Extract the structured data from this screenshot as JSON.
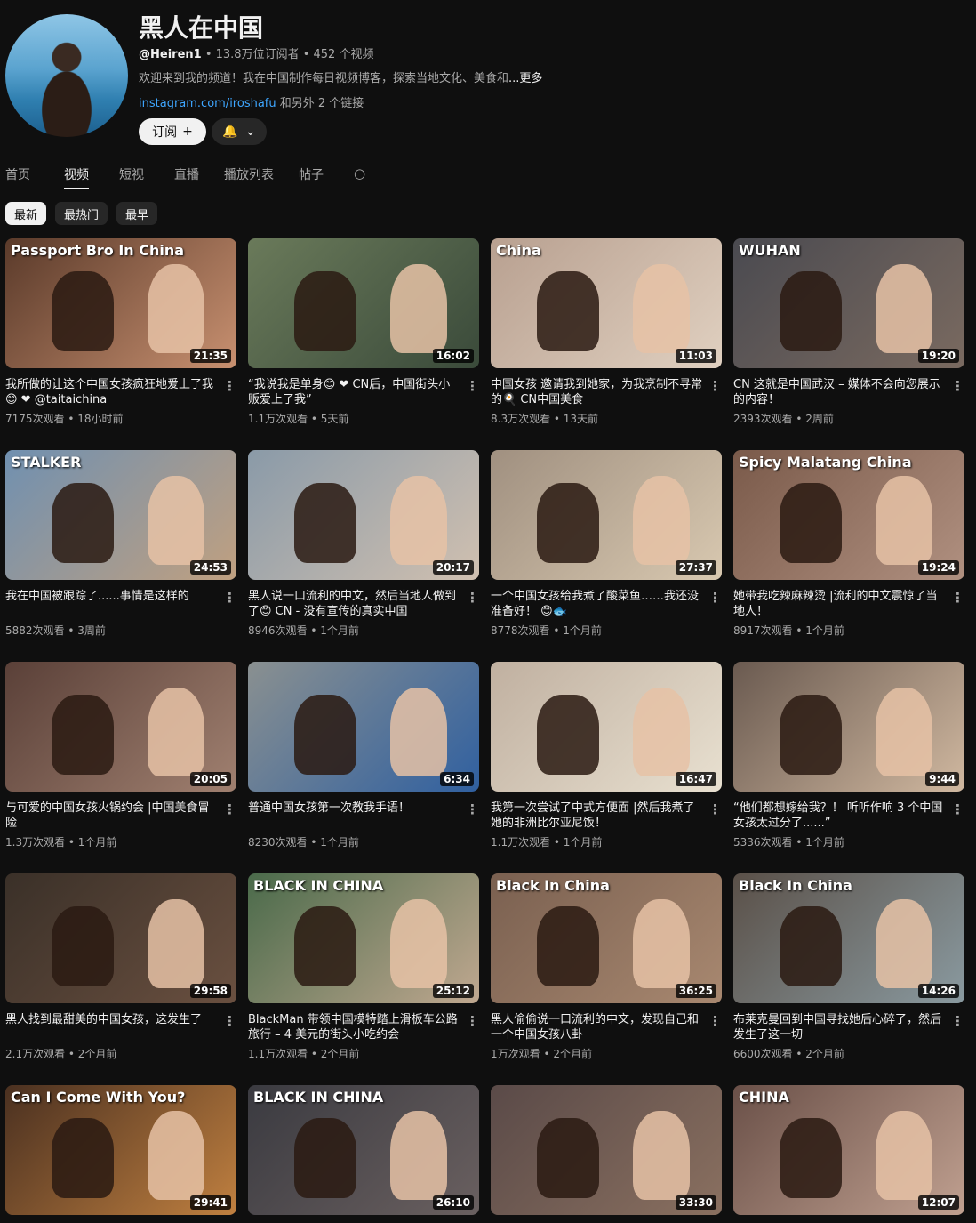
{
  "channel": {
    "title": "黑人在中国",
    "handle": "@Heiren1",
    "meta": " • 13.8万位订阅者 • 452 个视频",
    "description": "欢迎来到我的频道！我在中国制作每日视频博客，探索当地文化、美食和",
    "more": "...更多",
    "link": "instagram.com/iroshafu",
    "links_more": " 和另外 2 个链接",
    "subscribe_label": "订阅",
    "subscribe_icon": "+",
    "bell_icon": "🔔",
    "dropdown_icon": "⌄"
  },
  "tabs": [
    "首页",
    "视频",
    "短视",
    "直播",
    "播放列表",
    "帖子"
  ],
  "active_tab": 1,
  "search_icon": "○",
  "chips": [
    "最新",
    "最热门",
    "最早"
  ],
  "active_chip": 0,
  "kebab_icon": "⋮",
  "videos": [
    {
      "overlay": "Passport Bro In China",
      "duration": "21:35",
      "title": "我所做的让这个中国女孩疯狂地爱上了我😊 ❤ @taitaichina",
      "stats": "7175次观看 • 18小时前",
      "colors": [
        "#5a3a2a",
        "#c89070"
      ]
    },
    {
      "overlay": "",
      "duration": "16:02",
      "title": "“我说我是单身😊 ❤ CN后，中国街头小贩爱上了我”",
      "stats": "1.1万次观看 • 5天前",
      "colors": [
        "#6a7a5a",
        "#3a4a3a"
      ]
    },
    {
      "overlay": "China",
      "duration": "11:03",
      "title": "中国女孩 邀请我到她家，为我烹制不寻常的🍳 CN中国美食",
      "stats": "8.3万次观看 • 13天前",
      "colors": [
        "#b8a090",
        "#e0d0c0"
      ]
    },
    {
      "overlay": "WUHAN",
      "duration": "19:20",
      "title": "CN 这就是中国武汉 – 媒体不会向您展示的内容！",
      "stats": "2393次观看 • 2周前",
      "colors": [
        "#4a4a50",
        "#7a6a60"
      ]
    },
    {
      "overlay": "STALKER",
      "duration": "24:53",
      "title": "我在中国被跟踪了......事情是这样的",
      "stats": "5882次观看 • 3周前",
      "colors": [
        "#7090b0",
        "#c0a080"
      ]
    },
    {
      "overlay": "",
      "duration": "20:17",
      "title": "黑人说一口流利的中文，然后当地人做到了😊 CN - 没有宣传的真实中国",
      "stats": "8946次观看 • 1个月前",
      "colors": [
        "#8a9aa8",
        "#d0c0b0"
      ]
    },
    {
      "overlay": "",
      "duration": "27:37",
      "title": "一个中国女孩给我煮了酸菜鱼……我还没准备好！ 😊🐟",
      "stats": "8778次观看 • 1个月前",
      "colors": [
        "#a09080",
        "#d8c8b0"
      ]
    },
    {
      "overlay": "Spicy Malatang China",
      "duration": "19:24",
      "title": "她带我吃辣麻辣烫 |流利的中文震惊了当地人！",
      "stats": "8917次观看 • 1个月前",
      "colors": [
        "#7a5a4a",
        "#b09080"
      ]
    },
    {
      "overlay": "",
      "duration": "20:05",
      "title": "与可爱的中国女孩火锅约会 |中国美食冒险",
      "stats": "1.3万次观看 • 1个月前",
      "colors": [
        "#5a4038",
        "#a08070"
      ]
    },
    {
      "overlay": "",
      "duration": "6:34",
      "title": "普通中国女孩第一次教我手语！",
      "stats": "8230次观看 • 1个月前",
      "colors": [
        "#8a9090",
        "#3060a0"
      ]
    },
    {
      "overlay": "",
      "duration": "16:47",
      "title": "我第一次尝试了中式方便面 |然后我煮了她的非洲比尔亚尼饭！",
      "stats": "1.1万次观看 • 1个月前",
      "colors": [
        "#c0b0a0",
        "#e8e0d0"
      ]
    },
    {
      "overlay": "",
      "duration": "9:44",
      "title": "“他们都想嫁给我？！ 听听作响 3 个中国女孩太过分了......”",
      "stats": "5336次观看 • 1个月前",
      "colors": [
        "#6a5a50",
        "#d0b8a0"
      ]
    },
    {
      "overlay": "",
      "duration": "29:58",
      "title": "黑人找到最甜美的中国女孩，这发生了",
      "stats": "2.1万次观看 • 2个月前",
      "colors": [
        "#3a3028",
        "#6a5040"
      ]
    },
    {
      "overlay": "BLACK IN CHINA",
      "duration": "25:12",
      "title": "BlackMan 带领中国模特踏上滑板车公路旅行 – 4 美元的街头小吃约会",
      "stats": "1.1万次观看 • 2个月前",
      "colors": [
        "#4a6a4a",
        "#c0a890"
      ]
    },
    {
      "overlay": "Black In China",
      "duration": "36:25",
      "title": "黑人偷偷说一口流利的中文，发现自己和一个中国女孩八卦",
      "stats": "1万次观看 • 2个月前",
      "colors": [
        "#7a6050",
        "#a88870"
      ]
    },
    {
      "overlay": "Black In China",
      "duration": "14:26",
      "title": "布莱克曼回到中国寻找她后心碎了，然后发生了这一切",
      "stats": "6600次观看 • 2个月前",
      "colors": [
        "#5a5048",
        "#8a9aa0"
      ]
    },
    {
      "overlay": "Can I Come With You?",
      "duration": "29:41",
      "title": "",
      "stats": "",
      "colors": [
        "#4a3020",
        "#c08040"
      ]
    },
    {
      "overlay": "BLACK IN CHINA",
      "duration": "26:10",
      "title": "",
      "stats": "",
      "colors": [
        "#3a3a40",
        "#6a6060"
      ]
    },
    {
      "overlay": "",
      "duration": "33:30",
      "title": "",
      "stats": "",
      "colors": [
        "#5a4a48",
        "#8a7060"
      ]
    },
    {
      "overlay": "CHINA",
      "duration": "12:07",
      "title": "",
      "stats": "",
      "colors": [
        "#6a5048",
        "#c0a090"
      ]
    }
  ]
}
